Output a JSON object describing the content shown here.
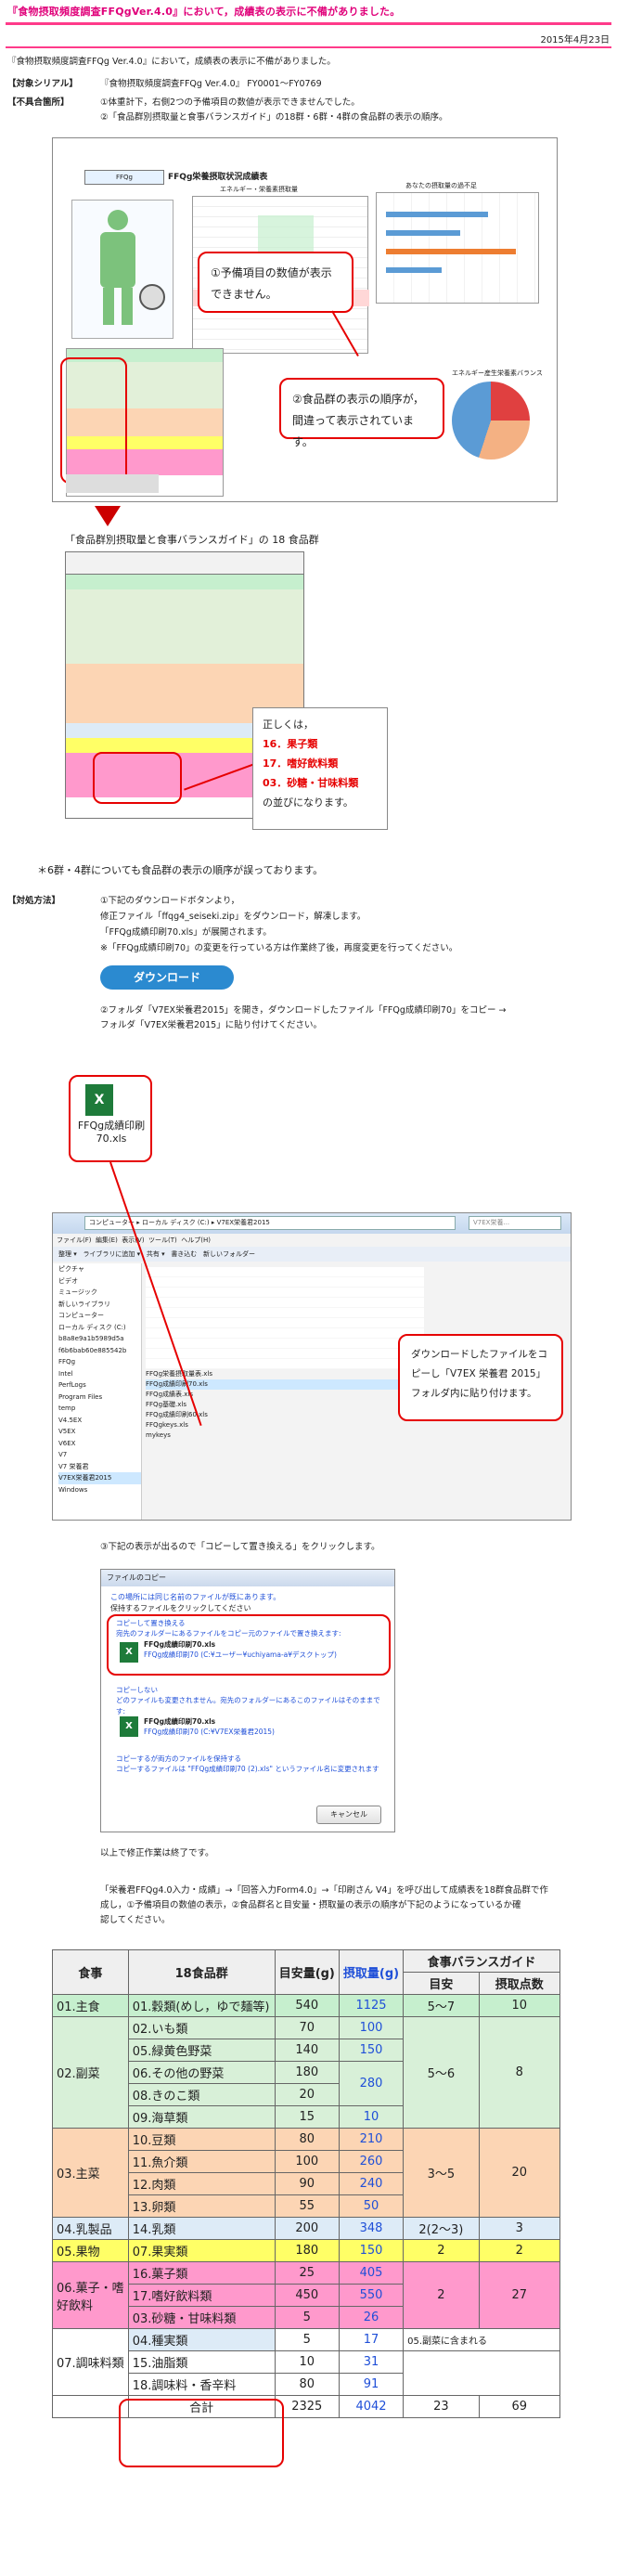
{
  "header": {
    "title": "『食物摂取頻度調査FFQgVer.4.0』において，成績表の表示に不備がありました。",
    "date": "2015年4月23日",
    "intro": "『食物摂取頻度調査FFQg Ver.4.0』において，成績表の表示に不備がありました。"
  },
  "serial": {
    "label": "【対象シリアル】",
    "value": "『食物摂取頻度調査FFQg Ver.4.0』 FY0001〜FY0769"
  },
  "issue": {
    "label": "【不具合箇所】",
    "line1": "①体重計下，右側2つの予備項目の数値が表示できませんでした。",
    "line2": "②「食品群別摂取量と食事バランスガイド」の18群・6群・4群の食品群の表示の順序。"
  },
  "screenshot1": {
    "sheet_title": "FFQg栄養摂取状況成績表",
    "section_title": "エネルギー・栄養素摂取量",
    "right_title": "あなたの摂取量の過不足",
    "chart_title": "エネルギー産生栄養素バランス",
    "callout1": "①予備項目の数値が表示できません。",
    "callout2": "②食品群の表示の順序が，間違って表示されています。"
  },
  "group_table_caption": "「食品群別摂取量と食事バランスガイド」の 18 食品群",
  "correct_box": {
    "lead": "正しくは，",
    "item1": "16．果子類",
    "item2": "17．嗜好飲料類",
    "item3": "03．砂糖・甘味料類",
    "tail": "の並びになります。"
  },
  "note_6_4": "＊6群・4群についても食品群の表示の順序が誤っております。",
  "fix": {
    "label": "【対処方法】",
    "step1": "①下記のダウンロードボタンより，",
    "step1b": "修正ファイル「ffqg4_seiseki.zip」をダウンロード，解凍します。",
    "step1c": "「FFQg成績印刷70.xls」が展開されます。",
    "step1d": "※「FFQg成績印刷70」の変更を行っている方は作業終了後，再度変更を行ってください。",
    "download_label": "ダウンロード",
    "step2": "②フォルダ「V7EX栄養君2015」を開き，ダウンロードしたファイル「FFQg成績印刷70」をコピー →",
    "step2b": "フォルダ「V7EX栄養君2015」に貼り付けてください。",
    "file_icon_label": "FFQg成績印刷70.xls",
    "explorer_path": "コンピューター ▸ ローカル ディスク (C:) ▸ V7EX栄養君2015",
    "explorer_search": "V7EX栄養...",
    "explorer_menu": [
      "ファイル(F)",
      "編集(E)",
      "表示(V)",
      "ツール(T)",
      "ヘルプ(H)"
    ],
    "explorer_toolbar": [
      "整理 ▾",
      "ライブラリに追加 ▾",
      "共有 ▾",
      "書き込む",
      "新しいフォルダー"
    ],
    "explorer_sidebar": [
      "ピクチャ",
      "ビデオ",
      "ミュージック",
      "新しいライブラリ",
      "コンピューター",
      "ローカル ディスク (C:)",
      "b8a8e9a1b5989d5a",
      "f6b6bab60e885542b",
      "FFQg",
      "Intel",
      "PerfLogs",
      "Program Files",
      "temp",
      "V4.5EX",
      "V5EX",
      "V6EX",
      "V7",
      "V7 栄養君",
      "V7EX栄養君2015",
      "Windows"
    ],
    "explorer_files": [
      "FFQg栄養摂取量表.xls",
      "FFQg成績印刷70.xls",
      "FFQg成績表.xls",
      "FFQg基礎.xls",
      "FFQg成績印刷60.xls",
      "FFQgkeys.xls",
      "mykeys"
    ],
    "copy_callout": "ダウンロードしたファイルをコピーし「V7EX 栄養君 2015」フォルダ内に貼り付けます。",
    "step3": "③下記の表示が出るので「コピーして置き換える」をクリックします。",
    "dialog_title": "ファイルのコピー",
    "dialog_msg1": "この場所には同じ名前のファイルが既にあります。",
    "dialog_msg2": "保持するファイルをクリックしてください",
    "opt1_title": "コピーして置き換える",
    "opt1_desc": "宛先のフォルダーにあるファイルをコピー元のファイルで置き換えます:",
    "opt1_file": "FFQg成績印刷70.xls",
    "opt1_path": "FFQg成績印刷70 (C:¥ユーザー¥uchiyama-a¥デスクトップ)",
    "opt2_title": "コピーしない",
    "opt2_desc": "どのファイルも変更されません。宛先のフォルダーにあるこのファイルはそのままです:",
    "opt2_file": "FFQg成績印刷70.xls",
    "opt2_path": "FFQg成績印刷70 (C:¥V7EX栄養君2015)",
    "opt3_title": "コピーするが両方のファイルを保持する",
    "opt3_desc": "コピーするファイルは \"FFQg成績印刷70 (2).xls\" というファイル名に変更されます",
    "dialog_cancel": "キャンセル",
    "done": "以上で修正作業は終了です。",
    "after1": "「栄養君FFQg4.0入力・成績」→「回答入力Form4.0」→「印刷さん V4」を呼び出して成績表を18群食品群で作",
    "after2": "成し，①予備項目の数値の表示，②食品群名と目安量・摂取量の表示の順序が下記のようになっているか確",
    "after3": "認してください。"
  },
  "final_table": {
    "headers": [
      "食事",
      "18食品群",
      "目安量(g)",
      "摂取量(g)",
      "食事バランスガイド",
      "目安",
      "摂取点数"
    ],
    "rows": [
      {
        "meal": "01.主食",
        "group": "01.穀類(めし，ゆで麺等)",
        "target": "540",
        "intake": "1125",
        "guide_target": "5〜7",
        "guide_score": "10"
      },
      {
        "meal": "02.副菜",
        "group": "02.いも類",
        "target": "70",
        "intake": "100",
        "guide_target": "5〜6",
        "guide_score": "8"
      },
      {
        "meal": "",
        "group": "05.緑黄色野菜",
        "target": "140",
        "intake": "150",
        "guide_target": "",
        "guide_score": ""
      },
      {
        "meal": "",
        "group": "06.その他の野菜",
        "target": "180",
        "intake": "280",
        "guide_target": "",
        "guide_score": ""
      },
      {
        "meal": "",
        "group": "08.きのこ類",
        "target": "20",
        "intake": "",
        "guide_target": "",
        "guide_score": ""
      },
      {
        "meal": "",
        "group": "09.海草類",
        "target": "15",
        "intake": "10",
        "guide_target": "",
        "guide_score": ""
      },
      {
        "meal": "03.主菜",
        "group": "10.豆類",
        "target": "80",
        "intake": "210",
        "guide_target": "3〜5",
        "guide_score": "20"
      },
      {
        "meal": "",
        "group": "11.魚介類",
        "target": "100",
        "intake": "260",
        "guide_target": "",
        "guide_score": ""
      },
      {
        "meal": "",
        "group": "12.肉類",
        "target": "90",
        "intake": "240",
        "guide_target": "",
        "guide_score": ""
      },
      {
        "meal": "",
        "group": "13.卵類",
        "target": "55",
        "intake": "50",
        "guide_target": "",
        "guide_score": ""
      },
      {
        "meal": "04.乳製品",
        "group": "14.乳類",
        "target": "200",
        "intake": "348",
        "guide_target": "2(2〜3)",
        "guide_score": "3"
      },
      {
        "meal": "05.果物",
        "group": "07.果実類",
        "target": "180",
        "intake": "150",
        "guide_target": "2",
        "guide_score": "2"
      },
      {
        "meal": "06.菓子・嗜好飲料",
        "group": "16.菓子類",
        "target": "25",
        "intake": "405",
        "guide_target": "2",
        "guide_score": "27"
      },
      {
        "meal": "",
        "group": "17.嗜好飲料類",
        "target": "450",
        "intake": "550",
        "guide_target": "",
        "guide_score": ""
      },
      {
        "meal": "",
        "group": "03.砂糖・甘味料類",
        "target": "5",
        "intake": "26",
        "guide_target": "",
        "guide_score": ""
      },
      {
        "meal": "07.調味料類",
        "group": "04.種実類",
        "target": "5",
        "intake": "17",
        "guide_target": "05.副菜に含まれる",
        "guide_score": ""
      },
      {
        "meal": "",
        "group": "15.油脂類",
        "target": "10",
        "intake": "31",
        "guide_target": "",
        "guide_score": ""
      },
      {
        "meal": "",
        "group": "18.調味料・香辛料",
        "target": "80",
        "intake": "91",
        "guide_target": "",
        "guide_score": ""
      }
    ],
    "total_label": "合計",
    "total_target": "2325",
    "total_intake": "4042",
    "total_guide_target": "23",
    "total_guide_score": "69"
  }
}
